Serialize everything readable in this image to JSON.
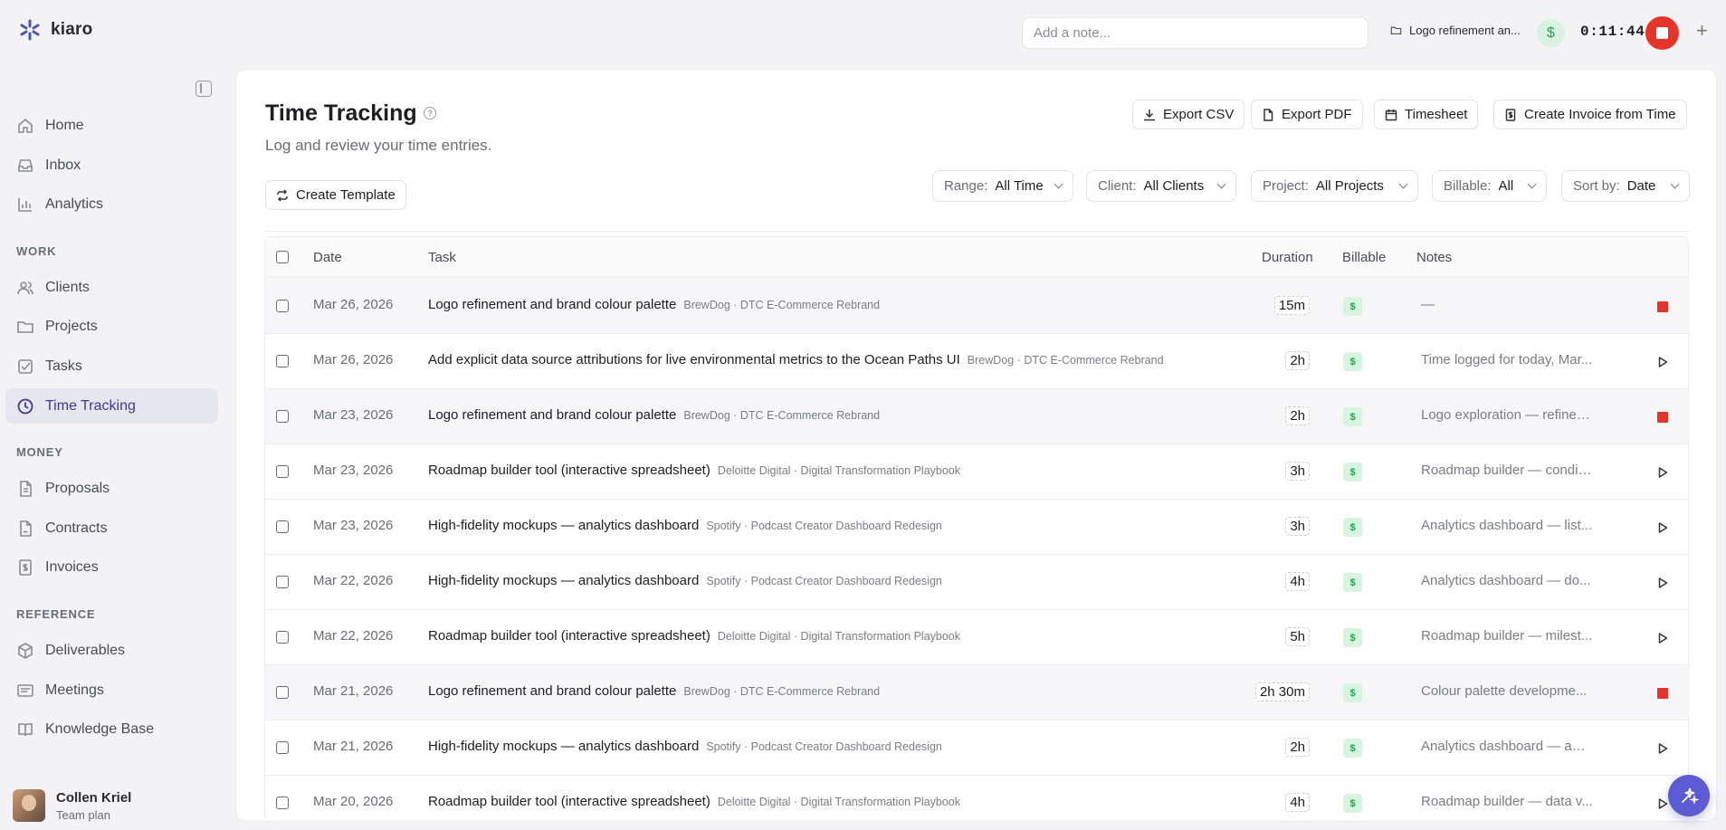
{
  "brand": {
    "name": "kiaro"
  },
  "sidebar": {
    "main_items": [
      {
        "label": "Home",
        "icon": "home-icon"
      },
      {
        "label": "Inbox",
        "icon": "inbox-icon"
      },
      {
        "label": "Analytics",
        "icon": "chart-icon"
      }
    ],
    "sections": [
      {
        "label": "WORK",
        "items": [
          {
            "label": "Clients",
            "icon": "users-icon"
          },
          {
            "label": "Projects",
            "icon": "folder-icon"
          },
          {
            "label": "Tasks",
            "icon": "checkbox-icon"
          },
          {
            "label": "Time Tracking",
            "icon": "clock-icon",
            "active": true
          }
        ]
      },
      {
        "label": "MONEY",
        "items": [
          {
            "label": "Proposals",
            "icon": "document-icon"
          },
          {
            "label": "Contracts",
            "icon": "contract-icon"
          },
          {
            "label": "Invoices",
            "icon": "invoice-icon"
          }
        ]
      },
      {
        "label": "REFERENCE",
        "items": [
          {
            "label": "Deliverables",
            "icon": "box-icon"
          },
          {
            "label": "Meetings",
            "icon": "meeting-icon"
          },
          {
            "label": "Knowledge Base",
            "icon": "book-icon"
          }
        ]
      }
    ],
    "user": {
      "name": "Collen Kriel",
      "plan": "Team plan"
    }
  },
  "topbar": {
    "note_placeholder": "Add a note...",
    "project": "Logo refinement an...",
    "billable_symbol": "$",
    "timer": "0:11:44"
  },
  "page": {
    "title": "Time Tracking",
    "subtitle": "Log and review your time entries.",
    "actions": {
      "export_csv": "Export CSV",
      "export_pdf": "Export PDF",
      "timesheet": "Timesheet",
      "create_invoice": "Create Invoice from Time",
      "create_template": "Create Template"
    },
    "filters": [
      {
        "label": "Range:",
        "value": "All Time"
      },
      {
        "label": "Client:",
        "value": "All Clients"
      },
      {
        "label": "Project:",
        "value": "All Projects"
      },
      {
        "label": "Billable:",
        "value": "All"
      },
      {
        "label": "Sort by:",
        "value": "Date"
      }
    ]
  },
  "table": {
    "columns": {
      "date": "Date",
      "task": "Task",
      "duration": "Duration",
      "billable": "Billable",
      "notes": "Notes"
    },
    "rows": [
      {
        "date": "Mar 26, 2026",
        "task": "Logo refinement and brand colour palette",
        "meta": "BrewDog · DTC E-Commerce Rebrand",
        "duration": "15m",
        "billable": "$",
        "notes": "—",
        "running": true
      },
      {
        "date": "Mar 26, 2026",
        "task": "Add explicit data source attributions for live environmental metrics to the Ocean Paths UI",
        "meta": "BrewDog · DTC E-Commerce Rebrand",
        "duration": "2h",
        "billable": "$",
        "notes": "Time logged for today, Mar...",
        "running": false
      },
      {
        "date": "Mar 23, 2026",
        "task": "Logo refinement and brand colour palette",
        "meta": "BrewDog · DTC E-Commerce Rebrand",
        "duration": "2h",
        "billable": "$",
        "notes": "Logo exploration — refined...",
        "running": true
      },
      {
        "date": "Mar 23, 2026",
        "task": "Roadmap builder tool (interactive spreadsheet)",
        "meta": "Deloitte Digital · Digital Transformation Playbook",
        "duration": "3h",
        "billable": "$",
        "notes": "Roadmap builder — conditi...",
        "running": false
      },
      {
        "date": "Mar 23, 2026",
        "task": "High-fidelity mockups — analytics dashboard",
        "meta": "Spotify · Podcast Creator Dashboard Redesign",
        "duration": "3h",
        "billable": "$",
        "notes": "Analytics dashboard — list...",
        "running": false
      },
      {
        "date": "Mar 22, 2026",
        "task": "High-fidelity mockups — analytics dashboard",
        "meta": "Spotify · Podcast Creator Dashboard Redesign",
        "duration": "4h",
        "billable": "$",
        "notes": "Analytics dashboard — do...",
        "running": false
      },
      {
        "date": "Mar 22, 2026",
        "task": "Roadmap builder tool (interactive spreadsheet)",
        "meta": "Deloitte Digital · Digital Transformation Playbook",
        "duration": "5h",
        "billable": "$",
        "notes": "Roadmap builder — milest...",
        "running": false
      },
      {
        "date": "Mar 21, 2026",
        "task": "Logo refinement and brand colour palette",
        "meta": "BrewDog · DTC E-Commerce Rebrand",
        "duration": "2h 30m",
        "billable": "$",
        "notes": "Colour palette developme...",
        "running": true
      },
      {
        "date": "Mar 21, 2026",
        "task": "High-fidelity mockups — analytics dashboard",
        "meta": "Spotify · Podcast Creator Dashboard Redesign",
        "duration": "2h",
        "billable": "$",
        "notes": "Analytics dashboard — aud...",
        "running": false
      },
      {
        "date": "Mar 20, 2026",
        "task": "Roadmap builder tool (interactive spreadsheet)",
        "meta": "Deloitte Digital · Digital Transformation Playbook",
        "duration": "4h",
        "billable": "$",
        "notes": "Roadmap builder — data v...",
        "running": false
      }
    ]
  },
  "colors": {
    "accent": "#3d3a8c",
    "stop": "#e5342b",
    "billable": "#26a052",
    "fab": "#5b5bd6"
  }
}
